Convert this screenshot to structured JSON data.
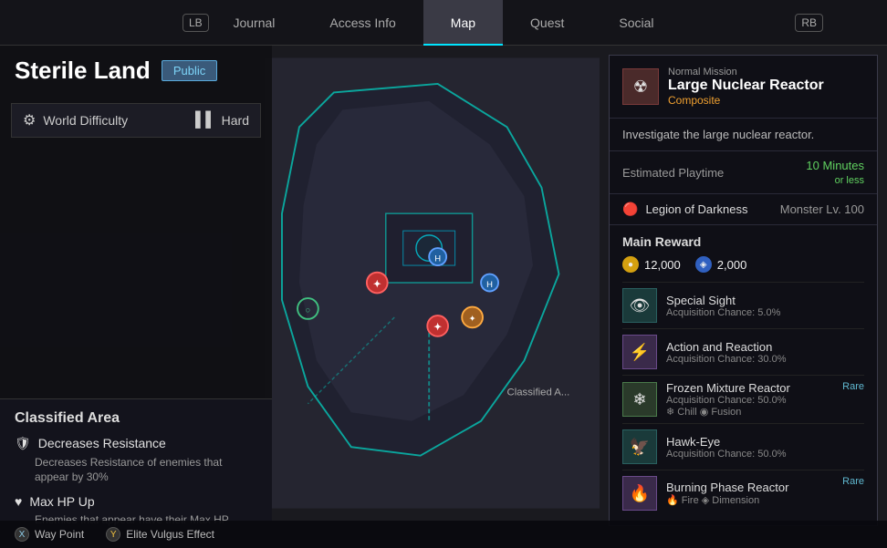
{
  "nav": {
    "lb": "LB",
    "rb": "RB",
    "items": [
      {
        "label": "Journal",
        "active": false
      },
      {
        "label": "Access Info",
        "active": false
      },
      {
        "label": "Map",
        "active": true
      },
      {
        "label": "Quest",
        "active": false
      },
      {
        "label": "Social",
        "active": false
      }
    ]
  },
  "left_panel": {
    "title": "Sterile Land",
    "public_badge": "Public",
    "world_difficulty": {
      "label": "World Difficulty",
      "value": "Hard"
    },
    "classified_area": {
      "title": "Classified Area",
      "buffs": [
        {
          "name": "Decreases Resistance",
          "icon": "🛡",
          "description": "Decreases Resistance of enemies that appear by 30%"
        },
        {
          "name": "Max HP Up",
          "icon": "♥",
          "description": "Enemies that appear have their Max HP"
        }
      ]
    }
  },
  "mission_panel": {
    "type": "Normal Mission",
    "name": "Large Nuclear Reactor",
    "tag": "Composite",
    "description": "Investigate the large nuclear reactor.",
    "playtime_label": "Estimated Playtime",
    "playtime_value": "10 Minutes",
    "playtime_sub": "or less",
    "enemy_name": "Legion of Darkness",
    "enemy_level": "Monster Lv. 100",
    "reward_title": "Main Reward",
    "gold_amount": "12,000",
    "blue_amount": "2,000",
    "rewards": [
      {
        "name": "Special Sight",
        "chance": "Acquisition Chance: 5.0%",
        "tags": "",
        "rare": false,
        "thumb_class": "teal",
        "icon": "👁"
      },
      {
        "name": "Action and Reaction",
        "chance": "Acquisition Chance: 30.0%",
        "tags": "",
        "rare": false,
        "thumb_class": "purple",
        "icon": "⚡"
      },
      {
        "name": "Frozen Mixture Reactor",
        "chance": "Acquisition Chance: 50.0%",
        "tags": "❄ Chill  ◉ Fusion",
        "rare": true,
        "thumb_class": "green",
        "icon": "❄"
      },
      {
        "name": "Hawk-Eye",
        "chance": "Acquisition Chance: 50.0%",
        "tags": "",
        "rare": false,
        "thumb_class": "teal",
        "icon": "🦅"
      },
      {
        "name": "Burning Phase Reactor",
        "chance": "",
        "tags": "🔥 Fire  ◈ Dimension",
        "rare": true,
        "thumb_class": "purple",
        "icon": "🔥"
      }
    ]
  },
  "bottom_bar": {
    "waypoint_label": "Way Point",
    "elite_label": "Elite Vulgus Effect"
  },
  "map": {
    "classified_label": "Classified A..."
  }
}
